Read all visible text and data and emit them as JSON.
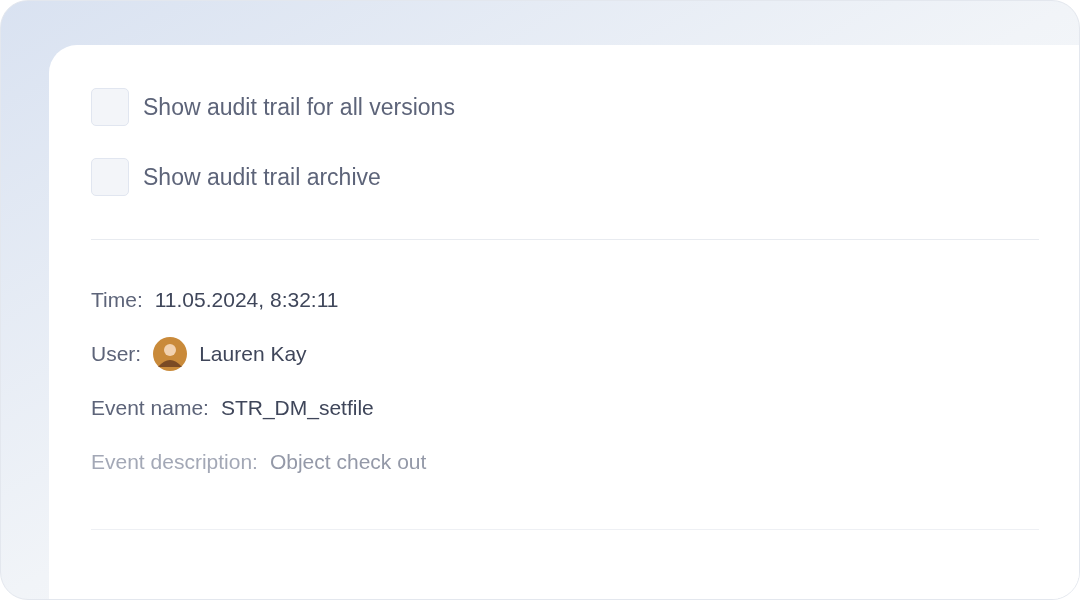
{
  "options": [
    {
      "label": "Show audit trail for all versions",
      "checked": false
    },
    {
      "label": "Show audit trail archive",
      "checked": false
    }
  ],
  "entry": {
    "fields": [
      {
        "kind": "text",
        "label": "Time:",
        "value": "11.05.2024, 8:32:11",
        "dimmed": false
      },
      {
        "kind": "user",
        "label": "User:",
        "value": "Lauren Kay",
        "dimmed": false
      },
      {
        "kind": "text",
        "label": "Event name:",
        "value": "STR_DM_setfile",
        "dimmed": false
      },
      {
        "kind": "text",
        "label": "Event description:",
        "value": "Object check out",
        "dimmed": true
      }
    ]
  }
}
